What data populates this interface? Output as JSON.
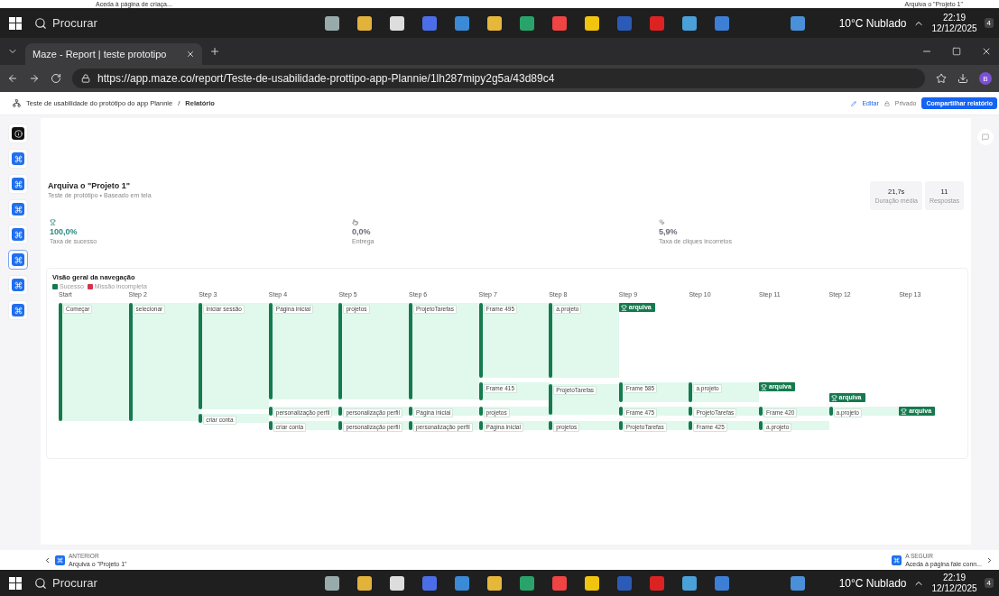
{
  "top_strip": {
    "left": "Aceda à página de criaça...",
    "right": "Arquiva o \"Projeto 1\""
  },
  "top_taskbar": {
    "search_placeholder": "Procurar",
    "weather": "10°C Nublado",
    "time": "22:19",
    "date": "12/12/2025",
    "notifications": "4"
  },
  "browser": {
    "tab_title": "Maze - Report | teste prototipo",
    "url": "https://app.maze.co/report/Teste-de-usabilidade-prottipo-app-Plannie/1lh287mipy2g5a/43d89c4",
    "profile": "B"
  },
  "app_header": {
    "project": "Teste de usabilidade do protótipo do app Plannie",
    "separator": "/",
    "page": "Relatório",
    "edit": "Editar",
    "privacy": "Privado",
    "share": "Compartilhar relatório"
  },
  "sidebar": {
    "items": [
      {
        "kind": "intro",
        "selected": false
      },
      {
        "kind": "task",
        "selected": false
      },
      {
        "kind": "task",
        "selected": false
      },
      {
        "kind": "task",
        "selected": false
      },
      {
        "kind": "task",
        "selected": false
      },
      {
        "kind": "task",
        "selected": true
      },
      {
        "kind": "task",
        "selected": false
      },
      {
        "kind": "task",
        "selected": false
      }
    ]
  },
  "block": {
    "title": "Arquiva o \"Projeto 1\"",
    "subtitle": "Teste de protótipo • Baseado em tela",
    "stats": [
      {
        "value": "21,7s",
        "label": "Duração média"
      },
      {
        "value": "11",
        "label": "Respostas"
      }
    ],
    "metrics": [
      {
        "kind": "success",
        "value": "100,0%",
        "label": "Taxa de sucesso",
        "color": "#2b8a83"
      },
      {
        "kind": "delivery",
        "value": "0,0%",
        "label": "Entrega",
        "color": "#6b6b78"
      },
      {
        "kind": "misclick",
        "value": "5,9%",
        "label": "Taxa de cliques incorretos",
        "color": "#6b6b78"
      }
    ]
  },
  "navigation": {
    "title": "Visão geral da navegação",
    "legend": [
      {
        "label": "Sucesso",
        "color": "#157a4e"
      },
      {
        "label": "Missão incompleta",
        "color": "#d6334a"
      }
    ],
    "steps": [
      {
        "label": "Start",
        "nodes": [
          {
            "kind": "page",
            "label": "Começar"
          }
        ]
      },
      {
        "label": "Step 2",
        "nodes": [
          {
            "kind": "page",
            "label": "selecionar"
          }
        ]
      },
      {
        "label": "Step 3",
        "nodes": [
          {
            "kind": "page",
            "label": "Iniciar sessão"
          },
          {
            "kind": "page",
            "label": "criar conta"
          }
        ]
      },
      {
        "label": "Step 4",
        "nodes": [
          {
            "kind": "page",
            "label": "Página inicial"
          },
          {
            "kind": "page",
            "label": "personalização perfil"
          },
          {
            "kind": "page",
            "label": "criar conta"
          }
        ]
      },
      {
        "label": "Step 5",
        "nodes": [
          {
            "kind": "page",
            "label": "projetos"
          },
          {
            "kind": "page",
            "label": "personalização perfil"
          },
          {
            "kind": "page",
            "label": "personalização perfil"
          }
        ]
      },
      {
        "label": "Step 6",
        "nodes": [
          {
            "kind": "page",
            "label": "ProjetoTarefas"
          },
          {
            "kind": "page",
            "label": "Página inicial"
          },
          {
            "kind": "page",
            "label": "personalização perfil"
          }
        ]
      },
      {
        "label": "Step 7",
        "nodes": [
          {
            "kind": "page",
            "label": "Frame 495"
          },
          {
            "kind": "page",
            "label": "Frame 415"
          },
          {
            "kind": "page",
            "label": "projetos"
          },
          {
            "kind": "page",
            "label": "Página inicial"
          }
        ]
      },
      {
        "label": "Step 8",
        "nodes": [
          {
            "kind": "page",
            "label": "a.projeto"
          },
          {
            "kind": "page",
            "label": "ProjetoTarefas"
          },
          {
            "kind": "page",
            "label": "projetos"
          }
        ]
      },
      {
        "label": "Step 9",
        "nodes": [
          {
            "kind": "goal",
            "label": "arquiva"
          },
          {
            "kind": "page",
            "label": "Frame 585"
          },
          {
            "kind": "page",
            "label": "Frame 475"
          },
          {
            "kind": "page",
            "label": "ProjetoTarefas"
          }
        ]
      },
      {
        "label": "Step 10",
        "nodes": [
          {
            "kind": "page",
            "label": "a.projeto"
          },
          {
            "kind": "page",
            "label": "ProjetoTarefas"
          },
          {
            "kind": "page",
            "label": "Frame 425"
          }
        ]
      },
      {
        "label": "Step 11",
        "nodes": [
          {
            "kind": "goal",
            "label": "arquiva"
          },
          {
            "kind": "page",
            "label": "Frame 420"
          },
          {
            "kind": "page",
            "label": "a.projeto"
          }
        ]
      },
      {
        "label": "Step 12",
        "nodes": [
          {
            "kind": "goal",
            "label": "arquiva"
          },
          {
            "kind": "page",
            "label": "a.projeto"
          }
        ]
      },
      {
        "label": "Step 13",
        "nodes": [
          {
            "kind": "goal",
            "label": "arquiva"
          }
        ]
      }
    ]
  },
  "footer": {
    "previous_caption": "ANTERIOR",
    "previous_title": "Arquiva o \"Projeto 1\"",
    "next_caption": "A SEGUIR",
    "next_title": "Aceda à página fale conn..."
  },
  "taskbar": {
    "search_placeholder": "Procurar",
    "weather": "10°C Nublado",
    "time": "22:19",
    "date": "12/12/2025",
    "notifications": "4"
  }
}
